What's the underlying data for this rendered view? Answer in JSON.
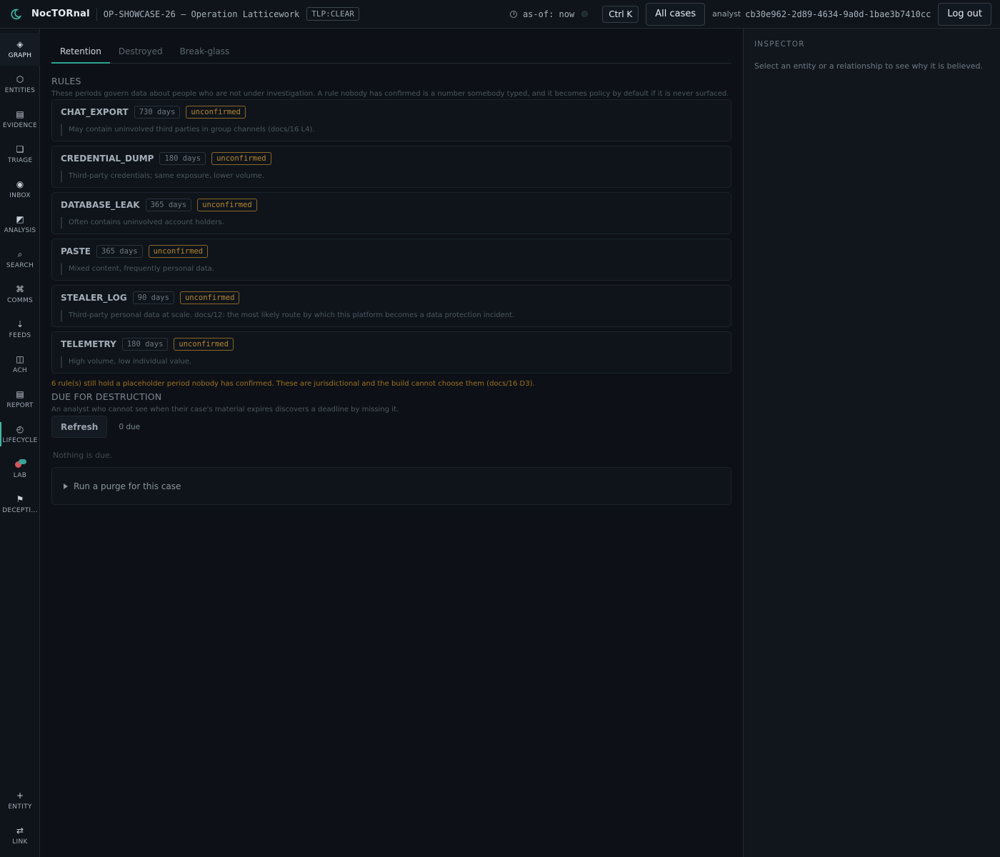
{
  "topbar": {
    "brand": "NocTORnal",
    "case_title": "OP-SHOWCASE-26 — Operation Latticework",
    "tlp": "TLP:CLEAR",
    "asof": "as-of: now",
    "shortcut": "Ctrl K",
    "all_cases": "All cases",
    "analyst_label": "analyst",
    "analyst_id": "cb30e962-2d89-4634-9a0d-1bae3b7410cc",
    "logout": "Log out"
  },
  "sidebar": {
    "items": [
      {
        "label": "GRAPH",
        "icon": "◈"
      },
      {
        "label": "ENTITIES",
        "icon": "⬡"
      },
      {
        "label": "EVIDENCE",
        "icon": "▤"
      },
      {
        "label": "TRIAGE",
        "icon": "❏"
      },
      {
        "label": "INBOX",
        "icon": "◉"
      },
      {
        "label": "ANALYSIS",
        "icon": "◩"
      },
      {
        "label": "SEARCH",
        "icon": "⌕"
      },
      {
        "label": "COMMS",
        "icon": "⌘"
      },
      {
        "label": "FEEDS",
        "icon": "⇣"
      },
      {
        "label": "ACH",
        "icon": "◫"
      },
      {
        "label": "REPORT",
        "icon": "▤"
      },
      {
        "label": "LIFECYCLE",
        "icon": "◴"
      },
      {
        "label": "LAB",
        "icon": ""
      },
      {
        "label": "DECEPTI...",
        "icon": "⚑"
      }
    ],
    "bottom": [
      {
        "label": "ENTITY",
        "icon": "+"
      },
      {
        "label": "LINK",
        "icon": "⇄"
      }
    ]
  },
  "tabs": [
    "Retention",
    "Destroyed",
    "Break-glass"
  ],
  "rules": {
    "title": "RULES",
    "description": "These periods govern data about people who are not under investigation. A rule nobody has confirmed is a number somebody typed, and it becomes policy by default if it is never surfaced.",
    "items": [
      {
        "name": "CHAT_EXPORT",
        "days": "730 days",
        "status": "unconfirmed",
        "note": "May contain uninvolved third parties in group channels (docs/16 L4)."
      },
      {
        "name": "CREDENTIAL_DUMP",
        "days": "180 days",
        "status": "unconfirmed",
        "note": "Third-party credentials; same exposure, lower volume."
      },
      {
        "name": "DATABASE_LEAK",
        "days": "365 days",
        "status": "unconfirmed",
        "note": "Often contains uninvolved account holders."
      },
      {
        "name": "PASTE",
        "days": "365 days",
        "status": "unconfirmed",
        "note": "Mixed content, frequently personal data."
      },
      {
        "name": "STEALER_LOG",
        "days": "90 days",
        "status": "unconfirmed",
        "note": "Third-party personal data at scale. docs/12: the most likely route by which this platform becomes a data protection incident."
      },
      {
        "name": "TELEMETRY",
        "days": "180 days",
        "status": "unconfirmed",
        "note": "High volume, low individual value."
      }
    ],
    "warning": "6 rule(s) still hold a placeholder period nobody has confirmed. These are jurisdictional and the build cannot choose them (docs/16 D3)."
  },
  "destruction": {
    "title": "DUE FOR DESTRUCTION",
    "description": "An analyst who cannot see when their case's material expires discovers a deadline by missing it.",
    "refresh": "Refresh",
    "due_count": "0 due",
    "empty": "Nothing is due.",
    "purge_label": "Run a purge for this case"
  },
  "inspector": {
    "title": "INSPECTOR",
    "text": "Select an entity or a relationship to see why it is believed."
  },
  "colors": {
    "accent": "#3fb9a6",
    "warning": "#b48630",
    "background": "#0d1117"
  }
}
